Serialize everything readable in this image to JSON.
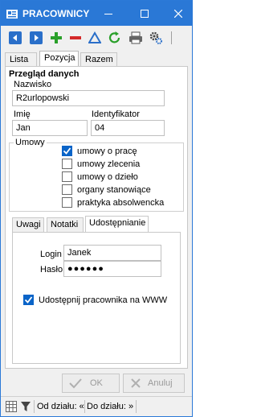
{
  "window": {
    "title": "PRACOWNICY",
    "minimize_icon": "minimize-icon",
    "maximize_icon": "maximize-icon",
    "close_icon": "close-icon"
  },
  "toolbar": {
    "icons": [
      "arrow-left-icon",
      "arrow-right-icon",
      "plus-icon",
      "minus-icon",
      "delta-icon",
      "refresh-icon",
      "print-icon",
      "settings-icon"
    ]
  },
  "tabs": [
    "Lista",
    "Pozycja",
    "Razem"
  ],
  "active_tab": "Pozycja",
  "form": {
    "section_title": "Przegląd danych",
    "surname_label": "Nazwisko",
    "surname_value": "R2urlopowski",
    "firstname_label": "Imię",
    "firstname_value": "Jan",
    "identifier_label": "Identyfikator",
    "identifier_value": "04",
    "contracts_group": "Umowy",
    "contracts": [
      {
        "label": "umowy o pracę",
        "checked": true
      },
      {
        "label": "umowy zlecenia",
        "checked": false
      },
      {
        "label": "umowy o dzieło",
        "checked": false
      },
      {
        "label": "organy stanowiące",
        "checked": false
      },
      {
        "label": "praktyka absolwencka",
        "checked": false
      }
    ]
  },
  "subtabs": [
    "Uwagi",
    "Notatki",
    "Udostępnianie"
  ],
  "active_subtab": "Udostępnianie",
  "sharing": {
    "login_label": "Login",
    "login_value": "Janek",
    "password_label": "Hasło",
    "password_value": "●●●●●●",
    "share_label": "Udostępnij pracownika na WWW",
    "share_checked": true
  },
  "buttons": {
    "ok_label": "OK",
    "cancel_label": "Anuluj"
  },
  "status": {
    "from_dept": "Od działu: «",
    "to_dept": "Do działu: »"
  },
  "colors": {
    "titlebar": "#2a78d6",
    "accent": "#0a64c8"
  }
}
